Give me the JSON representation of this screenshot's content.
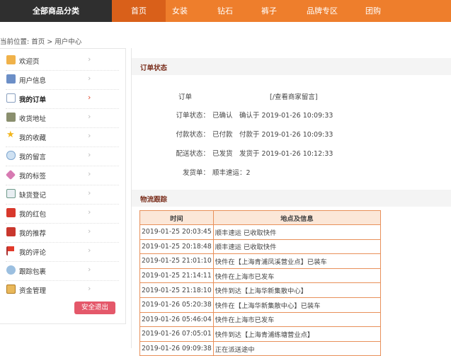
{
  "topnav": {
    "category_btn": "全部商品分类",
    "items": [
      "首页",
      "女装",
      "钻石",
      "裤子",
      "品牌专区",
      "团购"
    ],
    "active_index": 0
  },
  "breadcrumb": "当前位置: 首页 > 用户中心",
  "sidebar": {
    "items": [
      {
        "label": "欢迎页",
        "icon": "home-icon"
      },
      {
        "label": "用户信息",
        "icon": "id-card-icon"
      },
      {
        "label": "我的订单",
        "icon": "document-icon"
      },
      {
        "label": "收货地址",
        "icon": "address-book-icon"
      },
      {
        "label": "我的收藏",
        "icon": "star-icon"
      },
      {
        "label": "我的留言",
        "icon": "speech-bubble-icon"
      },
      {
        "label": "我的标签",
        "icon": "tag-icon"
      },
      {
        "label": "缺货登记",
        "icon": "clipboard-icon"
      },
      {
        "label": "我的红包",
        "icon": "red-envelope-icon"
      },
      {
        "label": "我的推荐",
        "icon": "recommend-icon"
      },
      {
        "label": "我的评论",
        "icon": "flag-icon"
      },
      {
        "label": "跟踪包裹",
        "icon": "package-track-icon"
      },
      {
        "label": "资金管理",
        "icon": "wallet-icon"
      }
    ],
    "active_index": 2,
    "logout_label": "安全退出"
  },
  "order_status": {
    "title": "订单状态",
    "order_no_label": "订单",
    "order_no_suffix": "[/查看商家留言]",
    "rows": [
      {
        "label": "订单状态：",
        "value": "已确认",
        "detail": "确认于 2019-01-26 10:09:33"
      },
      {
        "label": "付款状态：",
        "value": "已付款",
        "detail": "付款于 2019-01-26 10:09:33"
      },
      {
        "label": "配送状态：",
        "value": "已发货",
        "detail": "发货于 2019-01-26 10:12:33"
      }
    ],
    "shipping_label": "发货单：",
    "shipping_value": "顺丰速运：2"
  },
  "tracking": {
    "title": "物流跟踪",
    "headers": [
      "时间",
      "地点及信息"
    ],
    "rows": [
      [
        "2019-01-25 20:03:45",
        "顺丰速运 已收取快件"
      ],
      [
        "2019-01-25 20:18:48",
        "顺丰速运 已收取快件"
      ],
      [
        "2019-01-25 21:01:10",
        "快件在【上海青浦凤溪营业点】已装车"
      ],
      [
        "2019-01-25 21:14:11",
        "快件在上海市已发车"
      ],
      [
        "2019-01-25 21:18:10",
        "快件到达【上海华新集散中心】"
      ],
      [
        "2019-01-26 05:20:38",
        "快件在【上海华新集散中心】已装车"
      ],
      [
        "2019-01-26 05:46:04",
        "快件在上海市已发车"
      ],
      [
        "2019-01-26 07:05:01",
        "快件到达【上海青浦练塘营业点】"
      ],
      [
        "2019-01-26 09:09:38",
        "正在派送途中"
      ]
    ]
  }
}
